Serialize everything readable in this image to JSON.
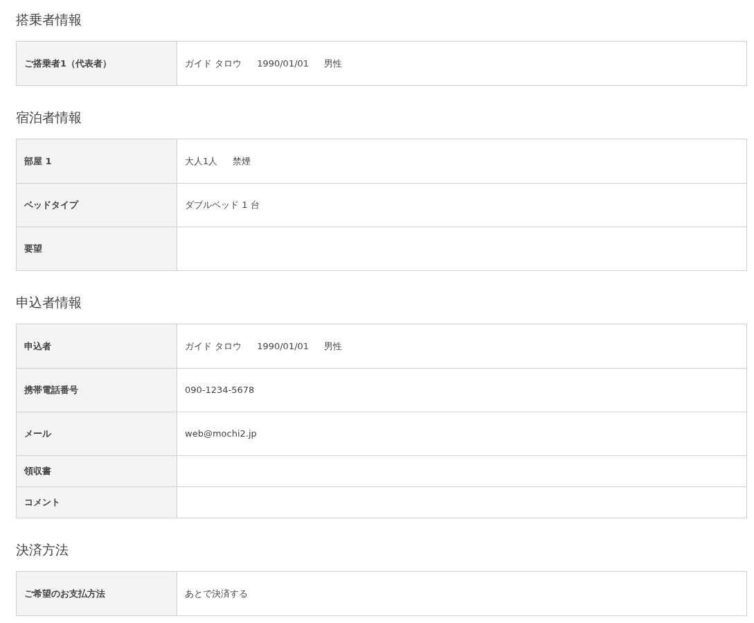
{
  "sections": [
    {
      "title": "搭乗者情報",
      "rows": [
        {
          "kind": "standard",
          "label": "ご搭乗者1（代表者）",
          "values": [
            "ガイド タロウ",
            "1990/01/01",
            "男性"
          ]
        }
      ]
    },
    {
      "title": "宿泊者情報",
      "rows": [
        {
          "kind": "standard",
          "label": "部屋 1",
          "values": [
            "大人1人",
            "禁煙"
          ]
        },
        {
          "kind": "standard",
          "label": "ベッドタイプ",
          "values": [
            "ダブルベッド 1 台"
          ]
        },
        {
          "kind": "standard",
          "label": "要望"
        }
      ]
    },
    {
      "title": "申込者情報",
      "rows": [
        {
          "kind": "standard",
          "label": "申込者",
          "values": [
            "ガイド タロウ",
            "1990/01/01",
            "男性"
          ]
        },
        {
          "kind": "standard",
          "label": "携帯電話番号",
          "values": [
            "090-1234-5678"
          ]
        },
        {
          "kind": "standard",
          "label": "メール",
          "values": [
            "web@mochi2.jp"
          ]
        },
        {
          "kind": "compact",
          "label": "領収書"
        },
        {
          "kind": "compact",
          "label": "コメント"
        }
      ]
    },
    {
      "title": "決済方法",
      "rows": [
        {
          "kind": "standard",
          "label": "ご希望のお支払方法",
          "values": [
            "あとで決済する"
          ]
        }
      ]
    }
  ]
}
